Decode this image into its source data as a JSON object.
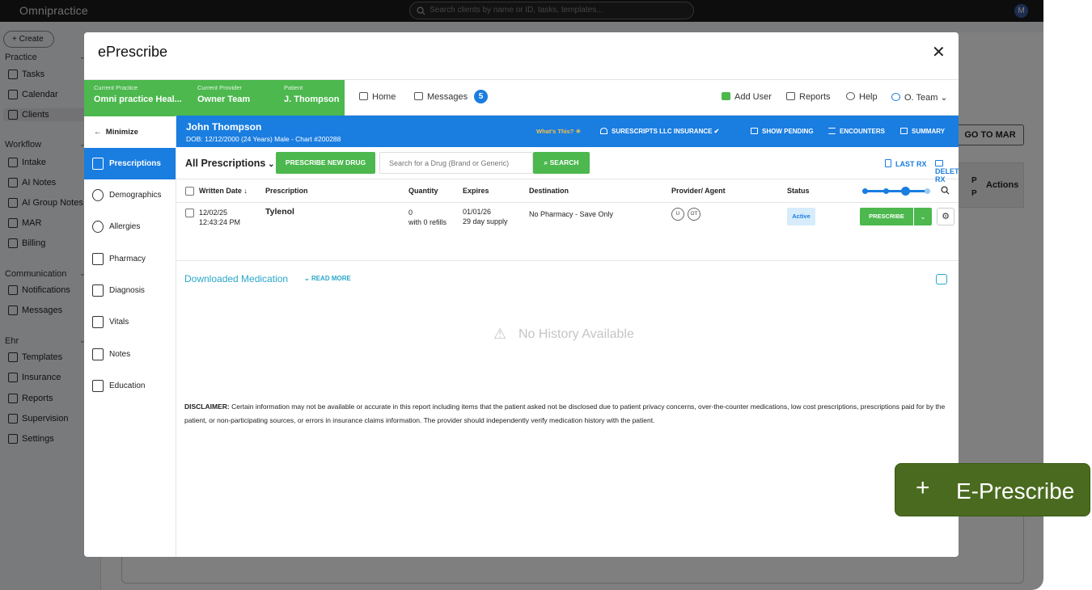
{
  "app": {
    "brand": "Omnipractice",
    "search_placeholder": "Search clients by name or ID, tasks, templates...",
    "avatar_initial": "M",
    "create_label": "Create"
  },
  "sidebar": {
    "sections": [
      {
        "title": "Practice",
        "items": [
          "Tasks",
          "Calendar",
          "Clients"
        ]
      },
      {
        "title": "Workflow",
        "items": [
          "Intake",
          "AI Notes",
          "AI Group Notes",
          "MAR",
          "Billing"
        ]
      },
      {
        "title": "Communication",
        "items": [
          "Notifications",
          "Messages"
        ]
      },
      {
        "title": "Ehr",
        "items": [
          "Templates",
          "Insurance",
          "Reports",
          "Supervision",
          "Settings"
        ]
      }
    ],
    "selected": "Clients"
  },
  "background": {
    "goto_mar": "GO TO MAR",
    "table_pp": "P\nP",
    "actions": "Actions"
  },
  "modal": {
    "title": "ePrescribe",
    "close": "✕",
    "header": {
      "current_practice_label": "Current Practice",
      "current_practice": "Omni practice Heal...",
      "current_provider_label": "Current Provider",
      "current_provider": "Owner Team",
      "patient_label": "Patient",
      "patient": "J. Thompson",
      "home": "Home",
      "messages": "Messages",
      "messages_count": "5",
      "add_user": "Add User",
      "reports": "Reports",
      "help": "Help",
      "user": "O. Team"
    },
    "left_nav": {
      "minimize": "Minimize",
      "items": [
        "Prescriptions",
        "Demographics",
        "Allergies",
        "Pharmacy",
        "Diagnosis",
        "Vitals",
        "Notes",
        "Education"
      ],
      "active": "Prescriptions"
    },
    "patient_bar": {
      "name": "John Thompson",
      "dob": "DOB: 12/12/2000 (24 Years) Male - Chart #200288",
      "whats_this": "What's This?",
      "insurance": "SURESCRIPTS LLC INSURANCE",
      "show_pending": "SHOW PENDING",
      "encounters": "ENCOUNTERS",
      "summary": "SUMMARY"
    },
    "toolbar": {
      "filter": "All Prescriptions",
      "prescribe_new": "PRESCRIBE NEW DRUG",
      "search_placeholder": "Search for a Drug (Brand or Generic)",
      "search_btn": "SEARCH",
      "last_rx": "LAST RX",
      "deleted_rx": "DELETED RX"
    },
    "table": {
      "headers": [
        "Written Date ↓",
        "Prescription",
        "Quantity",
        "Expires",
        "Destination",
        "Provider/ Agent",
        "Status"
      ],
      "rows": [
        {
          "written_date": "12/02/25",
          "written_time": "12:43:24 PM",
          "prescription": "Tylenol",
          "quantity": "0",
          "refills": "with 0 refills",
          "expires": "01/01/26",
          "supply": "29 day supply",
          "destination": "No Pharmacy - Save Only",
          "agent_u": "U",
          "agent_ot": "OT",
          "status": "Active",
          "action": "PRESCRIBE"
        }
      ]
    },
    "downloaded": {
      "title": "Downloaded Medication",
      "read_more": "READ MORE",
      "empty": "No History Available"
    },
    "disclaimer_label": "DISCLAIMER:",
    "disclaimer": "Certain information may not be available or accurate in this report including items that the patient asked not be disclosed due to patient privacy concerns, over-the-counter medications, low cost prescriptions, prescriptions paid for by the patient, or non-participating sources, or errors in insurance claims information. The provider should independently verify medication history with the patient."
  },
  "fab": {
    "plus": "+",
    "label": "E-Prescribe"
  }
}
